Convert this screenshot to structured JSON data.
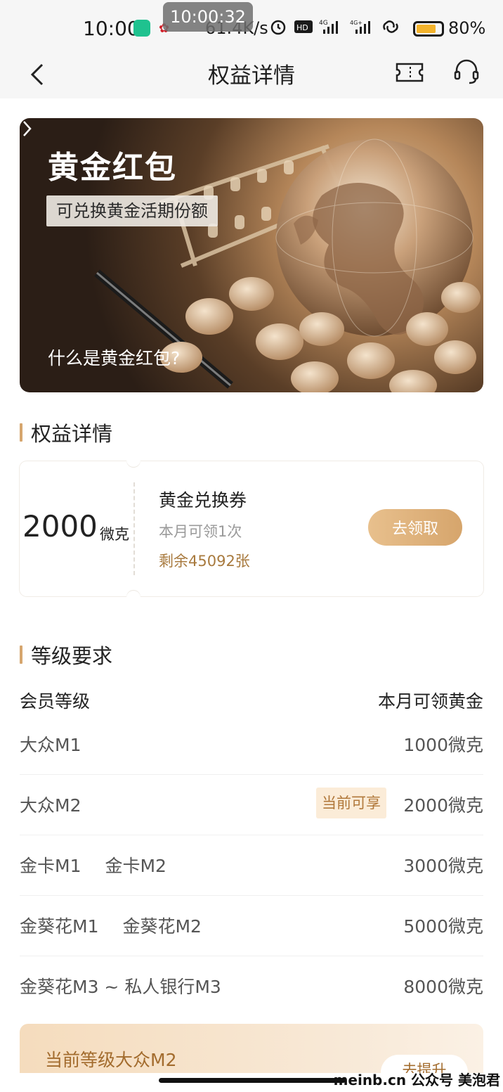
{
  "status_bar": {
    "time": "10:00",
    "overlay_time": "10:00:32",
    "network_speed": "61.4K/s",
    "battery": "80%",
    "battery_level": 0.8
  },
  "nav": {
    "title": "权益详情"
  },
  "banner": {
    "title": "黄金红包",
    "tag": "可兑换黄金活期份额",
    "link": "什么是黄金红包?"
  },
  "sections": {
    "benefit_title": "权益详情",
    "level_title": "等级要求"
  },
  "coupon": {
    "amount": "2000",
    "unit": "微克",
    "name": "黄金兑换券",
    "limit": "本月可领1次",
    "remain": "剩余45092张",
    "button": "去领取"
  },
  "level_table": {
    "header_left": "会员等级",
    "header_right": "本月可领黄金",
    "rows": [
      {
        "names": [
          "大众M1"
        ],
        "value": "1000微克",
        "badge": ""
      },
      {
        "names": [
          "大众M2"
        ],
        "value": "2000微克",
        "badge": "当前可享"
      },
      {
        "names": [
          "金卡M1",
          "金卡M2"
        ],
        "value": "3000微克",
        "badge": ""
      },
      {
        "names": [
          "金葵花M1",
          "金葵花M2"
        ],
        "value": "5000微克",
        "badge": ""
      },
      {
        "names": [
          "金葵花M3 ~ 私人银行M3"
        ],
        "value": "8000微克",
        "badge": ""
      }
    ]
  },
  "current_level": {
    "text": "当前等级大众M2",
    "button": "去提升"
  },
  "watermark": "meinb.cn 公众号 美泡君",
  "colors": {
    "accent": "#d6a66e",
    "remain": "#a87a3e",
    "badge_bg": "#fbecd8"
  }
}
